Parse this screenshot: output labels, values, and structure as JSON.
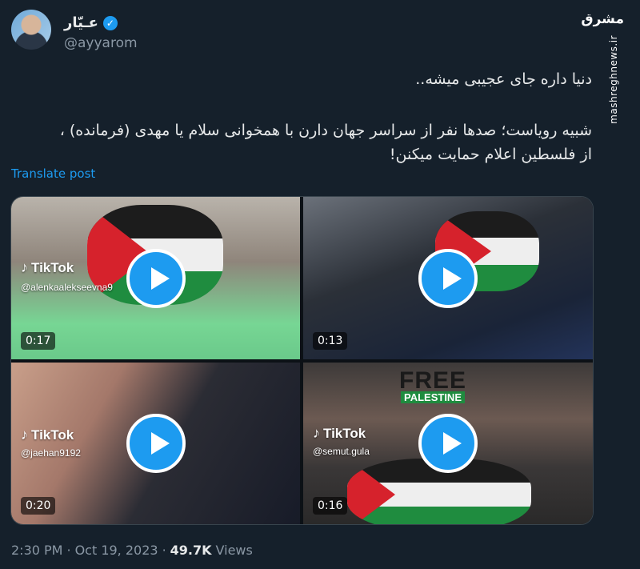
{
  "author": {
    "display_name": "عـیّار",
    "handle": "@ayyarom",
    "verified_mark": "✓"
  },
  "watermark": {
    "logo": "مشرق",
    "site": "mashreghnews.ir"
  },
  "tweet": {
    "line1": "دنیا داره جای عجیبی میشه..",
    "line2": "شبیه رویاست؛ صدها نفر از سراسر جهان دارن با همخوانی سلام یا مهدی (فرمانده) ،",
    "line3": "از فلسطین اعلام حمایت میکنن!"
  },
  "translate_label": "Translate post",
  "media": [
    {
      "tiktok": "TikTok",
      "user": "@alenkaalekseevna9",
      "duration": "0:17"
    },
    {
      "tiktok": "",
      "user": "",
      "duration": "0:13"
    },
    {
      "tiktok": "TikTok",
      "user": "@jaehan9192",
      "duration": "0:20"
    },
    {
      "tiktok": "TikTok",
      "user": "@semut.gula",
      "duration": "0:16",
      "overlay_1": "FREE",
      "overlay_2": "PALESTINE"
    }
  ],
  "footer": {
    "time": "2:30 PM",
    "sep": "·",
    "date": "Oct 19, 2023",
    "views_count": "49.7K",
    "views_label": "Views"
  },
  "icons": {
    "tiktok_icon": "tiktok-icon",
    "play_icon": "play-icon",
    "verified_icon": "verified-badge-icon"
  },
  "colors": {
    "background": "#15202b",
    "accent": "#1d9bf0",
    "text": "#e7e9ea",
    "muted": "#8b98a5"
  }
}
